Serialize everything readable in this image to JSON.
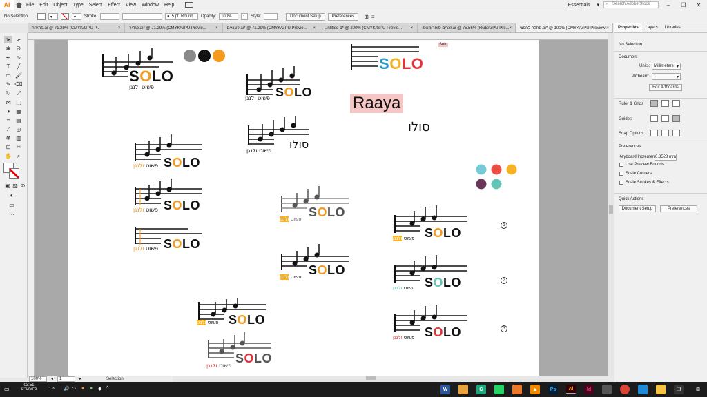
{
  "menubar": {
    "app_logo": "Ai",
    "items": [
      "File",
      "Edit",
      "Object",
      "Type",
      "Select",
      "Effect",
      "View",
      "Window",
      "Help"
    ],
    "workspace": "Essentials",
    "search_placeholder": "Search Adobe Stock"
  },
  "controlbar": {
    "selection": "No Selection",
    "stroke_label": "Stroke:",
    "brush": "5 pt. Round",
    "opacity_label": "Opacity:",
    "opacity_value": "100%",
    "style_label": "Style:",
    "doc_setup": "Document Setup",
    "preferences": "Preferences"
  },
  "tabs": [
    {
      "label": "פתיחה.ai @ 71.29% (CMYK/GPU P...",
      "active": false
    },
    {
      "label": "כגדיר.ai* @ 71.29% (CMYK/GPU Previe...",
      "active": false
    },
    {
      "label": "לוגואים.ai* @ 71.29% (CMYK/GPU Previe...",
      "active": false
    },
    {
      "label": "Untitled-1* @ 200% (CMYK/GPU Previe...",
      "active": false
    },
    {
      "label": "זכרים סופר מאסו.ai @ 75.56% (RGB/GPU Pre...",
      "active": false
    },
    {
      "label": "סחלה לחפצי.ai* @ 100% (CMYK/GPU Preview)",
      "active": true
    }
  ],
  "status": {
    "zoom": "100%",
    "artboard": "1",
    "tool": "Selection"
  },
  "panel": {
    "tabs": [
      "Properties",
      "Layers",
      "Libraries"
    ],
    "selection": "No Selection",
    "document": "Document",
    "units_label": "Units:",
    "units_value": "Millimeters",
    "artboard_label": "Artboard:",
    "artboard_value": "1",
    "edit_artboards": "Edit Artboards",
    "rulers_grids": "Ruler & Grids",
    "guides": "Guides",
    "snap_options": "Snap Options",
    "preferences": "Preferences",
    "keyboard_increment_label": "Keyboard Increment:",
    "keyboard_increment_value": "0.3528 mm",
    "use_preview_bounds": "Use Preview Bounds",
    "scale_corners": "Scale Corners",
    "scale_strokes": "Scale Strokes & Effects",
    "quick_actions": "Quick Actions",
    "doc_setup_btn": "Document Setup",
    "preferences_btn": "Preferences"
  },
  "artwork": {
    "solo_word": "SOLO",
    "hebrew_tagline": "פשוט ולנגן",
    "hebrew_tagline_yellow_a": "פשוט",
    "hebrew_tagline_yellow_b": "ולנגן",
    "hebrew_solo": "סולו",
    "raaya": "Raaya",
    "small_label": "Solo",
    "numbers": [
      "1",
      "2",
      "3"
    ],
    "colors": {
      "black": "#111111",
      "orange": "#f39a1f",
      "yellow": "#f5b324",
      "blue": "#2b9ac8",
      "red": "#e2343a",
      "teal": "#65c6b8",
      "gray": "#8a8a8a",
      "gray_dark": "#555555",
      "plum": "#6a3559",
      "light_blue": "#76cbd6",
      "coral": "#ea4b43",
      "pink": "#f5c6c6"
    }
  },
  "taskbar": {
    "time": "03:51",
    "date": "כ\"ו/חש\"ט",
    "lang": "עבר"
  }
}
